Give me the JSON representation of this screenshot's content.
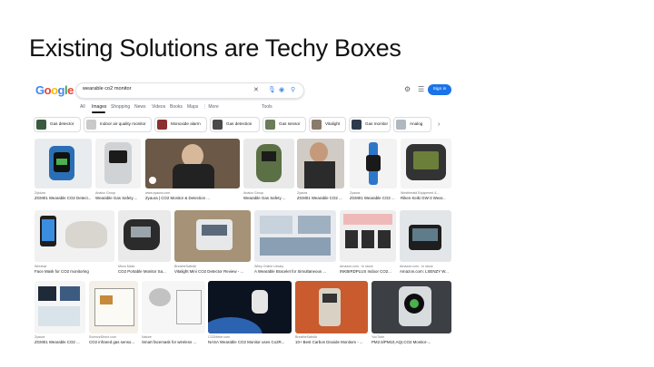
{
  "slide": {
    "title": "Existing Solutions are Techy Boxes"
  },
  "search": {
    "logo": "Google",
    "query": "wearable co2 monitor",
    "signin": "Sign in"
  },
  "tabs": [
    "All",
    "Images",
    "Shopping",
    "News",
    "Videos",
    "Books",
    "Maps",
    "⋮ More"
  ],
  "tools_label": "Tools",
  "chips": [
    "Gas detector",
    "Indoor air quality monitor",
    "Monoxide alarm",
    "Gas detection",
    "Gas sensor",
    "Vitalight",
    "Gas monitor",
    "Analog"
  ],
  "results": [
    {
      "source": "Zyklura",
      "title": "ZGM01 Wearable CO2 Detect..."
    },
    {
      "source": "Analox Group",
      "title": "Wearable Gas Safety ..."
    },
    {
      "source": "www.zyaura.com",
      "title": "Zyaura | CO2 Monitor & Detection ..."
    },
    {
      "source": "Analox Group",
      "title": "Wearable Gas Safety ..."
    },
    {
      "source": "Zyaura",
      "title": "ZGM01 Wearable CO2 ..."
    },
    {
      "source": "Zyaura",
      "title": "ZGM01 Wearable CO2 ..."
    },
    {
      "source": "Westherald Equipment &...",
      "title": "Riken Keiki GW-3 Wear..."
    },
    {
      "source": "Wrexbar",
      "title": "Face Mask for CO2 monitoring"
    },
    {
      "source": "Micro Matic",
      "title": "CO2 Portable Monitor Sa..."
    },
    {
      "source": "BreatheSafeAir",
      "title": "Vitalight Mini CO2 Detector Review - ..."
    },
    {
      "source": "Wiley Online Library",
      "title": "A Wearable Bracelet for Simultaneous ..."
    },
    {
      "source": "Amazon.com · In stock",
      "title": "INKBIRDPLUS Indoor CO2..."
    },
    {
      "source": "Amazon.com · In stock",
      "title": "Amazon.com: LSENZY W..."
    },
    {
      "source": "Zyaura",
      "title": "ZGM01 Wearable CO2 ..."
    },
    {
      "source": "ScienceDirect.com",
      "title": "CO2 infrared gas senso..."
    },
    {
      "source": "Nature",
      "title": "Smart facemask for wireless ..."
    },
    {
      "source": "CO2Meter.com",
      "title": "NASA Wearable CO2 Monitor uses Co2R..."
    },
    {
      "source": "BreatheSafeAir",
      "title": "10+ Best Carbon Dioxide Monitors - ..."
    },
    {
      "source": "YouTube",
      "title": "PM2.5/PM10,AQI,CO2 Monitor-..."
    }
  ]
}
